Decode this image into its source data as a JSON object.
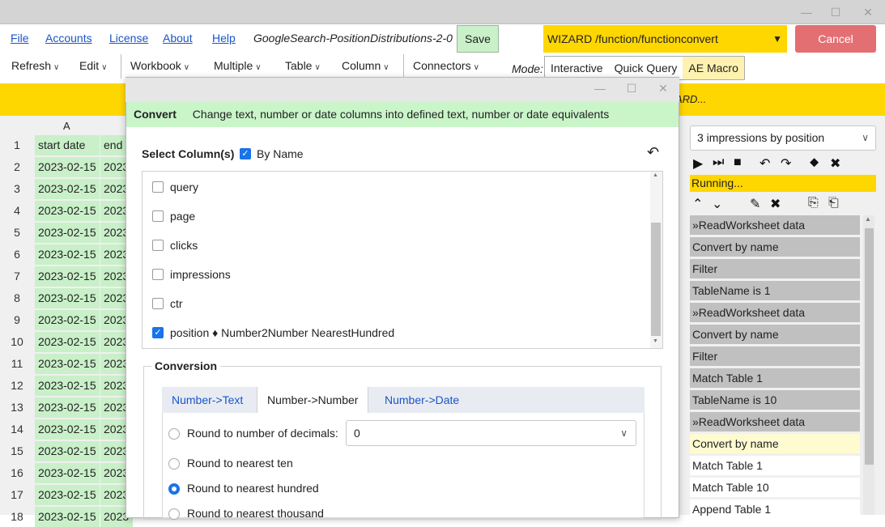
{
  "menu": {
    "links": [
      "File",
      "Accounts",
      "License",
      "About",
      "Help"
    ],
    "doc_title": "GoogleSearch-PositionDistributions-2-0",
    "save_label": "Save",
    "wizard_value": "WIZARD /function/functionconvert",
    "cancel_label": "Cancel"
  },
  "toolbar": {
    "items": [
      "Refresh",
      "Edit",
      "Workbook",
      "Multiple",
      "Table",
      "Column",
      "Connectors"
    ],
    "mode_label": "Mode:",
    "modes": [
      "Interactive",
      "Quick Query",
      "AE Macro"
    ],
    "active_mode": "AE Macro"
  },
  "banner": {
    "text": "ZARD..."
  },
  "sheet": {
    "column_letter": "A",
    "rows": [
      {
        "n": "1",
        "a": "start date",
        "b": "end"
      },
      {
        "n": "2",
        "a": "2023-02-15",
        "b": "2023"
      },
      {
        "n": "3",
        "a": "2023-02-15",
        "b": "2023"
      },
      {
        "n": "4",
        "a": "2023-02-15",
        "b": "2023"
      },
      {
        "n": "5",
        "a": "2023-02-15",
        "b": "2023"
      },
      {
        "n": "6",
        "a": "2023-02-15",
        "b": "2023"
      },
      {
        "n": "7",
        "a": "2023-02-15",
        "b": "2023"
      },
      {
        "n": "8",
        "a": "2023-02-15",
        "b": "2023"
      },
      {
        "n": "9",
        "a": "2023-02-15",
        "b": "2023"
      },
      {
        "n": "10",
        "a": "2023-02-15",
        "b": "2023"
      },
      {
        "n": "11",
        "a": "2023-02-15",
        "b": "2023"
      },
      {
        "n": "12",
        "a": "2023-02-15",
        "b": "2023"
      },
      {
        "n": "13",
        "a": "2023-02-15",
        "b": "2023"
      },
      {
        "n": "14",
        "a": "2023-02-15",
        "b": "2023"
      },
      {
        "n": "15",
        "a": "2023-02-15",
        "b": "2023"
      },
      {
        "n": "16",
        "a": "2023-02-15",
        "b": "2023"
      },
      {
        "n": "17",
        "a": "2023-02-15",
        "b": "2023"
      },
      {
        "n": "18",
        "a": "2023-02-15",
        "b": "2023"
      }
    ]
  },
  "right_panel": {
    "step_select": "3 impressions by position",
    "status": "Running...",
    "macro_items": [
      {
        "label": "»ReadWorksheet data",
        "state": "done"
      },
      {
        "label": "Convert by name",
        "state": "done"
      },
      {
        "label": "Filter",
        "state": "done"
      },
      {
        "label": "TableName is 1",
        "state": "done"
      },
      {
        "label": "»ReadWorksheet data",
        "state": "done"
      },
      {
        "label": "Convert by name",
        "state": "done"
      },
      {
        "label": "Filter",
        "state": "done"
      },
      {
        "label": "Match Table 1",
        "state": "done"
      },
      {
        "label": "TableName is 10",
        "state": "done"
      },
      {
        "label": "»ReadWorksheet data",
        "state": "done"
      },
      {
        "label": "Convert by name",
        "state": "current"
      },
      {
        "label": "Match Table 1",
        "state": "pending"
      },
      {
        "label": "Match Table 10",
        "state": "pending"
      },
      {
        "label": "Append Table 1",
        "state": "pending"
      }
    ]
  },
  "dialog": {
    "header_title": "Convert",
    "header_desc": "Change text, number or date columns into defined text, number or date equivalents",
    "select_label": "Select Column(s)",
    "by_name_label": "By Name",
    "columns": [
      {
        "name": "query",
        "checked": false
      },
      {
        "name": "page",
        "checked": false
      },
      {
        "name": "clicks",
        "checked": false
      },
      {
        "name": "impressions",
        "checked": false
      },
      {
        "name": "ctr",
        "checked": false
      },
      {
        "name": "position ♦ Number2Number NearestHundred",
        "checked": true
      }
    ],
    "conversion_label": "Conversion",
    "tabs": [
      "Number->Text",
      "Number->Number",
      "Number->Date"
    ],
    "active_tab": "Number->Number",
    "decimals_label": "Round to number of decimals:",
    "decimals_value": "0",
    "options": [
      {
        "label": "Round to nearest ten",
        "checked": false
      },
      {
        "label": "Round to nearest hundred",
        "checked": true
      },
      {
        "label": "Round to nearest thousand",
        "checked": false
      }
    ]
  }
}
